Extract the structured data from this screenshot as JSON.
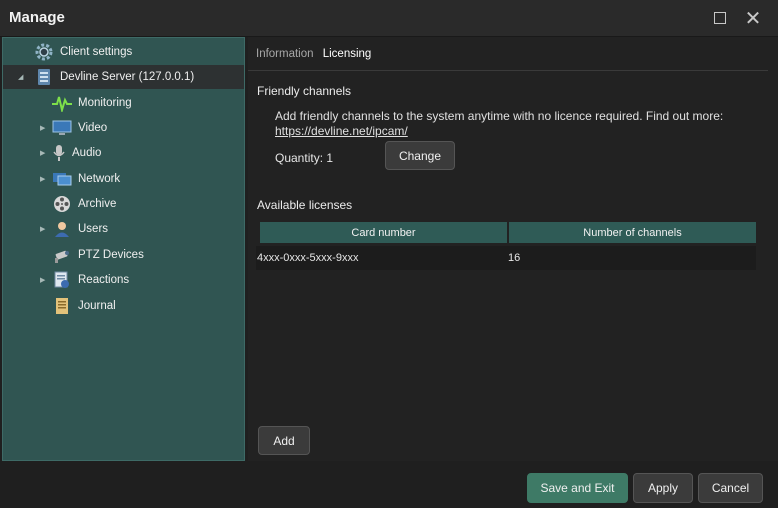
{
  "window": {
    "title": "Manage"
  },
  "sidebar": {
    "items": [
      {
        "label": "Client settings",
        "icon": "gear-icon"
      },
      {
        "label": "Devline Server (127.0.0.1)",
        "icon": "server-icon"
      },
      {
        "label": "Monitoring",
        "icon": "monitoring-icon"
      },
      {
        "label": "Video",
        "icon": "monitor-icon"
      },
      {
        "label": "Audio",
        "icon": "microphone-icon"
      },
      {
        "label": "Network",
        "icon": "network-icon"
      },
      {
        "label": "Archive",
        "icon": "film-reel-icon"
      },
      {
        "label": "Users",
        "icon": "user-icon"
      },
      {
        "label": "PTZ Devices",
        "icon": "ptz-camera-icon"
      },
      {
        "label": "Reactions",
        "icon": "reactions-icon"
      },
      {
        "label": "Journal",
        "icon": "journal-icon"
      }
    ]
  },
  "main": {
    "tabs": [
      {
        "label": "Information"
      },
      {
        "label": "Licensing"
      }
    ],
    "friendly": {
      "title": "Friendly channels",
      "description": "Add friendly channels to the system anytime with no licence required. Find out more:",
      "link": "https://devline.net/ipcam/",
      "quantity": "Quantity: 1",
      "change_label": "Change"
    },
    "licenses": {
      "title": "Available licenses",
      "columns": [
        "Card number",
        "Number of channels"
      ],
      "rows": [
        {
          "card": "4xxx-0xxx-5xxx-9xxx",
          "channels": "16"
        }
      ],
      "add_label": "Add"
    }
  },
  "footer": {
    "save_exit_label": "Save and Exit",
    "apply_label": "Apply",
    "cancel_label": "Cancel"
  },
  "colors": {
    "sidebar_bg": "#305552",
    "accent_green": "#3e7a66",
    "table_header": "#2f5b56"
  }
}
